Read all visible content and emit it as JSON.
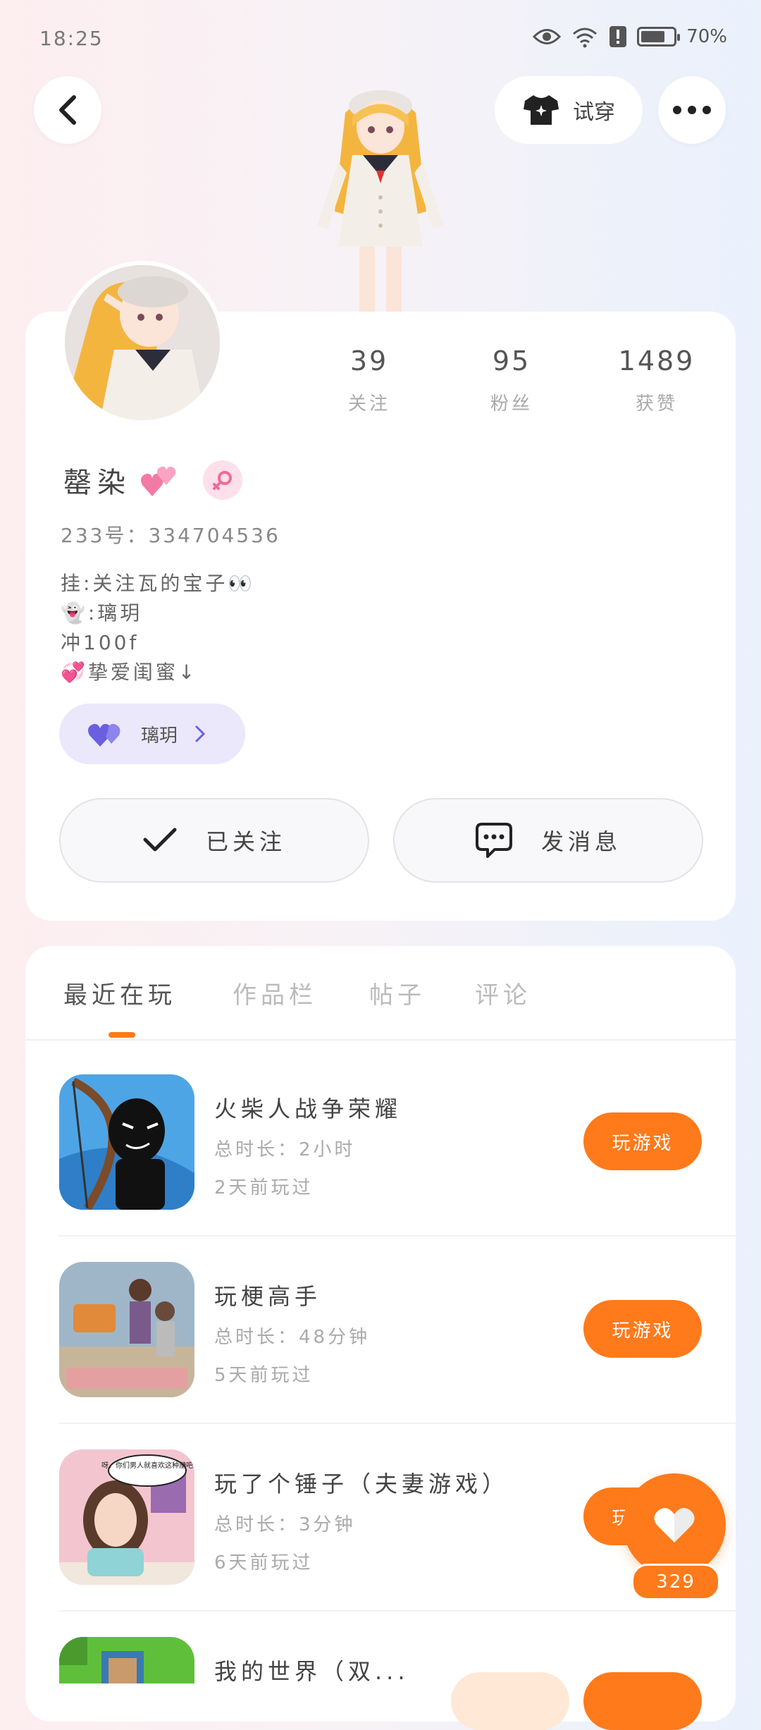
{
  "status_bar": {
    "time": "18:25",
    "battery": "70%"
  },
  "header": {
    "tryon_label": "试穿"
  },
  "stats": [
    {
      "value": "39",
      "label": "关注"
    },
    {
      "value": "95",
      "label": "粉丝"
    },
    {
      "value": "1489",
      "label": "获赞"
    }
  ],
  "profile": {
    "name": "罄染",
    "uid": "233号：334704536",
    "bio": [
      "挂:关注瓦的宝子👀",
      "👻:璃玥",
      "冲100f",
      "💞挚爱闺蜜↓"
    ],
    "club_label": "璃玥"
  },
  "actions": {
    "followed_label": "已关注",
    "message_label": "发消息"
  },
  "tabs": [
    "最近在玩",
    "作品栏",
    "帖子",
    "评论"
  ],
  "games": [
    {
      "title": "火柴人战争荣耀",
      "duration": "总时长：2小时",
      "last_played": "2天前玩过",
      "button": "玩游戏"
    },
    {
      "title": "玩梗高手",
      "duration": "总时长：48分钟",
      "last_played": "5天前玩过",
      "button": "玩游戏"
    },
    {
      "title": "玩了个锤子（夫妻游戏）",
      "duration": "总时长：3分钟",
      "last_played": "6天前玩过",
      "button": "玩游戏"
    },
    {
      "title": "我的世界（双...",
      "duration": "",
      "last_played": "",
      "button": ""
    }
  ],
  "game_icon_caption": "呀，你们男人就喜欢这种屋吧",
  "likes": {
    "count": "329"
  },
  "colors": {
    "accent": "#ff7a1a",
    "club_bg": "#ebe8fb"
  }
}
